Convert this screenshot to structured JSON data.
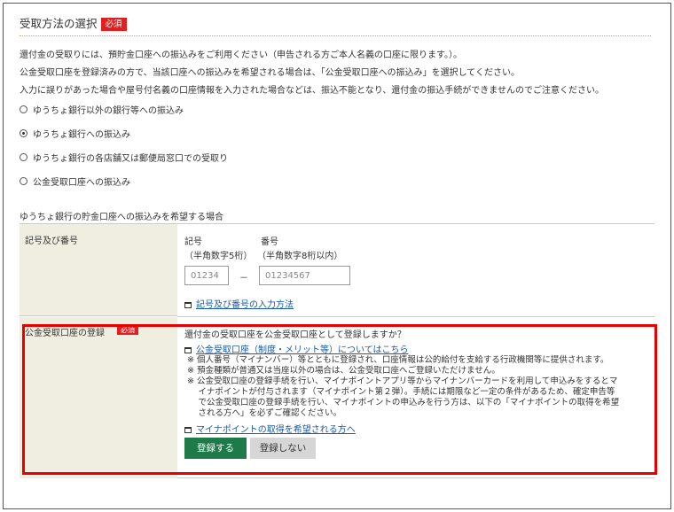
{
  "section": {
    "title": "受取方法の選択",
    "required_badge": "必須",
    "descriptions": [
      "還付金の受取りには、預貯金口座への振込みをご利用ください（申告される方ご本人名義の口座に限ります。）。",
      "公金受取口座を登録済みの方で、当該口座への振込みを希望される場合は、「公金受取口座への振込み」を選択してください。",
      "入力に誤りがあった場合や屋号付名義の口座情報を入力された場合などは、振込不能となり、還付金の振込手続ができませんのでご注意ください。"
    ],
    "options": [
      {
        "label": "ゆうちょ銀行以外の銀行等への振込み",
        "selected": false
      },
      {
        "label": "ゆうちょ銀行への振込み",
        "selected": true
      },
      {
        "label": "ゆうちょ銀行の各店舗又は郵便局窓口での受取り",
        "selected": false
      },
      {
        "label": "公金受取口座への振込み",
        "selected": false
      }
    ]
  },
  "yucho": {
    "heading": "ゆうちょ銀行の貯金口座への振込みを希望する場合",
    "row_label": "記号及び番号",
    "kigo_label": "記号",
    "kigo_hint": "（半角数字5桁）",
    "bango_label": "番号",
    "bango_hint": "（半角数字8桁以内）",
    "kigo_placeholder": "01234",
    "bango_placeholder": "01234567",
    "separator": "－",
    "howto_link": "記号及び番号の入力方法"
  },
  "koukin": {
    "row_label": "公金受取口座の登録",
    "required_badge": "必須",
    "question": "還付金の受取口座を公金受取口座として登録しますか？",
    "about_link": "公金受取口座（制度・メリット等）についてはこちら",
    "notes": [
      "※ 個人番号（マイナンバー）等とともに登録され、口座情報は公的給付を支給する行政機関等に提供されます。",
      "※ 預金種類が普通又は当座以外の場合は、公金受取口座へご登録いただけません。",
      "※ 公金受取口座の登録手続を行い、マイナポイントアプリ等からマイナンバーカードを利用して申込みをするとマ",
      "　 イナポイントが付与されます（マイナポイント第２弾）。手続には期限など一定の条件があるため、確定申告等",
      "　 で公金受取口座の登録手続を行い、マイナポイントの申込みを行う方は、以下の「マイナポイントの取得を希望",
      "　 される方へ」を必ずご確認ください。"
    ],
    "point_link": "マイナポイントの取得を希望される方へ",
    "register_button": "登録する",
    "no_register_button": "登録しない"
  },
  "colors": {
    "required_red": "#e02020",
    "highlight_red": "#e60000",
    "register_green": "#1f7a4a",
    "link_blue": "#1a5aa8",
    "label_cell_bg": "#efeee0"
  }
}
